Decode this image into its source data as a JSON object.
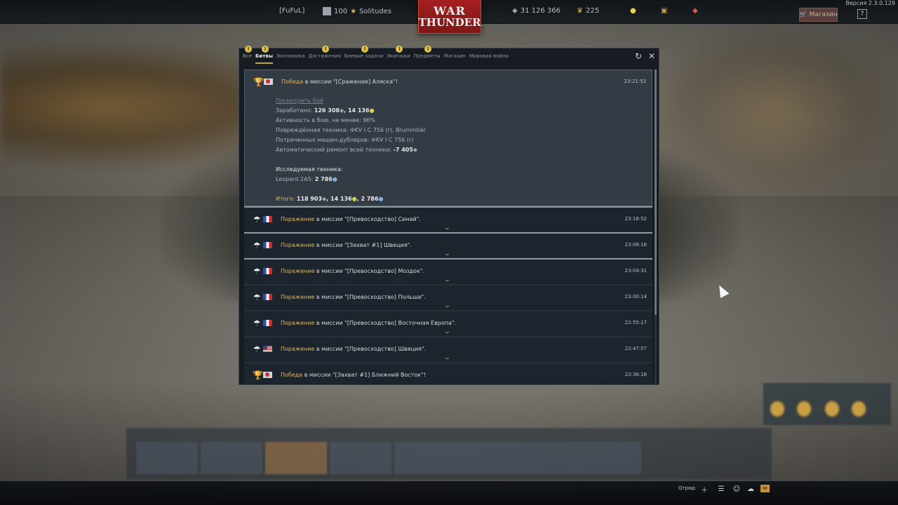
{
  "version": "Версия 2.3.0.129",
  "topbar": {
    "squadron_tag": "[FuFuL]",
    "player_level": "100",
    "player_name": "Solitudes",
    "logo_line1": "WAR",
    "logo_line2": "THUNDER",
    "silver_lions": "31 126 366",
    "golden_eagles": "225",
    "shop_label": "Магазин",
    "help_label": "?"
  },
  "dialog": {
    "tabs": [
      {
        "label": "Все",
        "notif": true,
        "active": false
      },
      {
        "label": "Битвы",
        "notif": true,
        "active": true
      },
      {
        "label": "Экономика",
        "notif": false,
        "active": false
      },
      {
        "label": "Достижения",
        "notif": true,
        "active": false
      },
      {
        "label": "Боевые задачи",
        "notif": true,
        "active": false
      },
      {
        "label": "Экипажи",
        "notif": true,
        "active": false
      },
      {
        "label": "Предметы",
        "notif": true,
        "active": false
      },
      {
        "label": "Магазин",
        "notif": false,
        "active": false
      },
      {
        "label": "Мировая война",
        "notif": false,
        "active": false
      }
    ],
    "notif_glyph": "!",
    "refresh_icon": "↻",
    "close_icon": "✕"
  },
  "expanded_entry": {
    "result": "Победа",
    "text": " в миссии \"[Сражение] Аляска\"!",
    "time": "23:21:53",
    "view_battle": "Посмотреть бой",
    "earned_label": "Заработано: ",
    "earned_lions": "126 308",
    "earned_rp": "14 136",
    "activity": "Активность в бою, не менее: 96%",
    "damaged": "Повреждённая техника: ✣KV I C 756 (r), Brummbär",
    "backups": "Потраченных машин-дублеров: ✣KV I C 756 (r)",
    "repair_label": "Автоматический ремонт всей техники: ",
    "repair_value": "-7 405",
    "research_header": "Исследуемая техника:",
    "research_vehicle": "Leopard 2A5: ",
    "research_value": "2 786",
    "total_label": "Итого: ",
    "total_lions": "118 903",
    "total_rp": "14 136",
    "total_crp": "2 786",
    "flag": "jp",
    "icon": "trophy"
  },
  "entries": [
    {
      "result": "Поражение",
      "text": " в миссии \"[Превосходство] Синай\".",
      "time": "23:18:52",
      "flag": "fr",
      "icon": "parachute",
      "sep": true
    },
    {
      "result": "Поражение",
      "text": " в миссии \"[Захват #1] Швеция\".",
      "time": "23:08:16",
      "flag": "fr",
      "icon": "parachute",
      "sep": true
    },
    {
      "result": "Поражение",
      "text": " в миссии \"[Превосходство] Моздок\".",
      "time": "23:04:31",
      "flag": "fr",
      "icon": "parachute",
      "sep": true
    },
    {
      "result": "Поражение",
      "text": " в миссии \"[Превосходство] Польша\".",
      "time": "23:00:14",
      "flag": "fr",
      "icon": "parachute",
      "sep": false
    },
    {
      "result": "Поражение",
      "text": " в миссии \"[Превосходство] Восточная Европа\".",
      "time": "22:55:17",
      "flag": "fr",
      "icon": "parachute",
      "sep": false
    },
    {
      "result": "Поражение",
      "text": " в миссии \"[Превосходство] Швеция\".",
      "time": "22:47:57",
      "flag": "us",
      "icon": "parachute",
      "sep": false
    },
    {
      "result": "Победа",
      "text": " в миссии \"[Захват #1] Ближний Восток\"!",
      "time": "22:36:18",
      "flag": "jp",
      "icon": "trophy",
      "sep": false
    }
  ],
  "bottombar": {
    "squad_label": "Отряд:"
  }
}
